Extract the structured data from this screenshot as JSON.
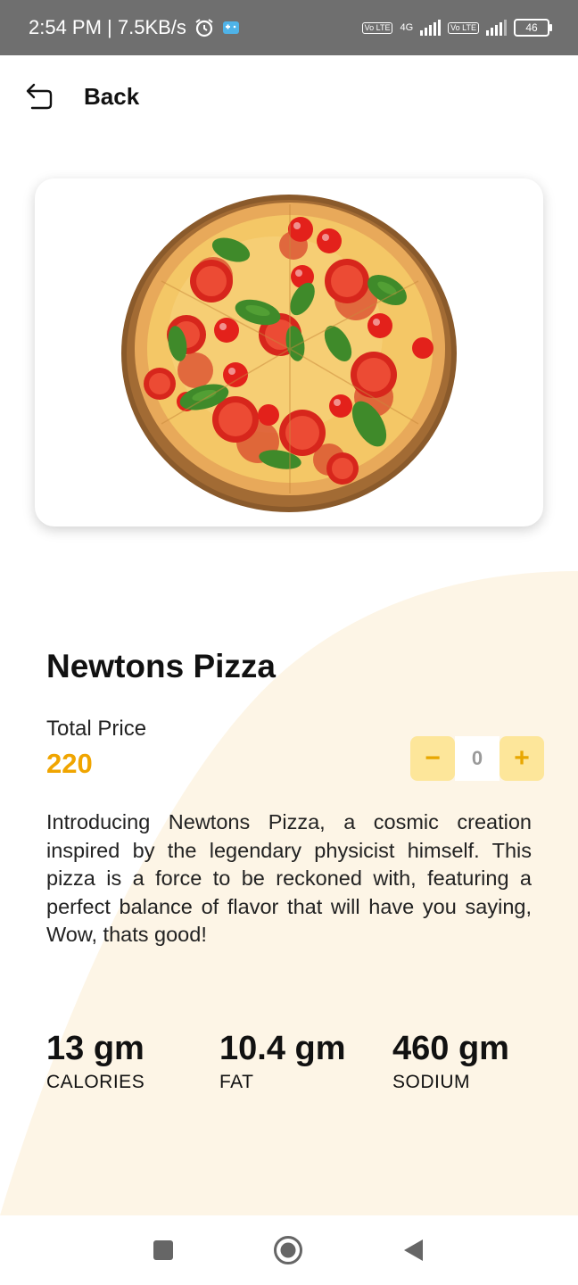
{
  "status_bar": {
    "time_speed": "2:54 PM | 7.5KB/s",
    "net_4g": "4G",
    "volte1": "Vo LTE",
    "volte2": "Vo LTE",
    "battery": "46"
  },
  "header": {
    "back_label": "Back"
  },
  "product": {
    "image_icon": "pizza-image",
    "title": "Newtons Pizza",
    "price_label": "Total Price",
    "price": "220",
    "quantity": "0",
    "minus_symbol": "−",
    "plus_symbol": "+",
    "description": "Introducing Newtons Pizza, a cosmic creation inspired by the legendary physicist himself. This pizza is a force to be reckoned with, featuring a perfect balance of flavor that will have you saying, Wow, thats good!"
  },
  "nutrition": [
    {
      "value": "13 gm",
      "label": "CALORIES"
    },
    {
      "value": "10.4 gm",
      "label": "FAT"
    },
    {
      "value": "460 gm",
      "label": "SODIUM"
    }
  ],
  "colors": {
    "accent": "#f0a500",
    "stepper_bg": "#fde69a",
    "cream": "#fdf5e6",
    "status_bar": "#6f6f6f"
  },
  "nav": {
    "recents_icon": "square-icon",
    "home_icon": "circle-icon",
    "back_icon": "triangle-back-icon"
  }
}
